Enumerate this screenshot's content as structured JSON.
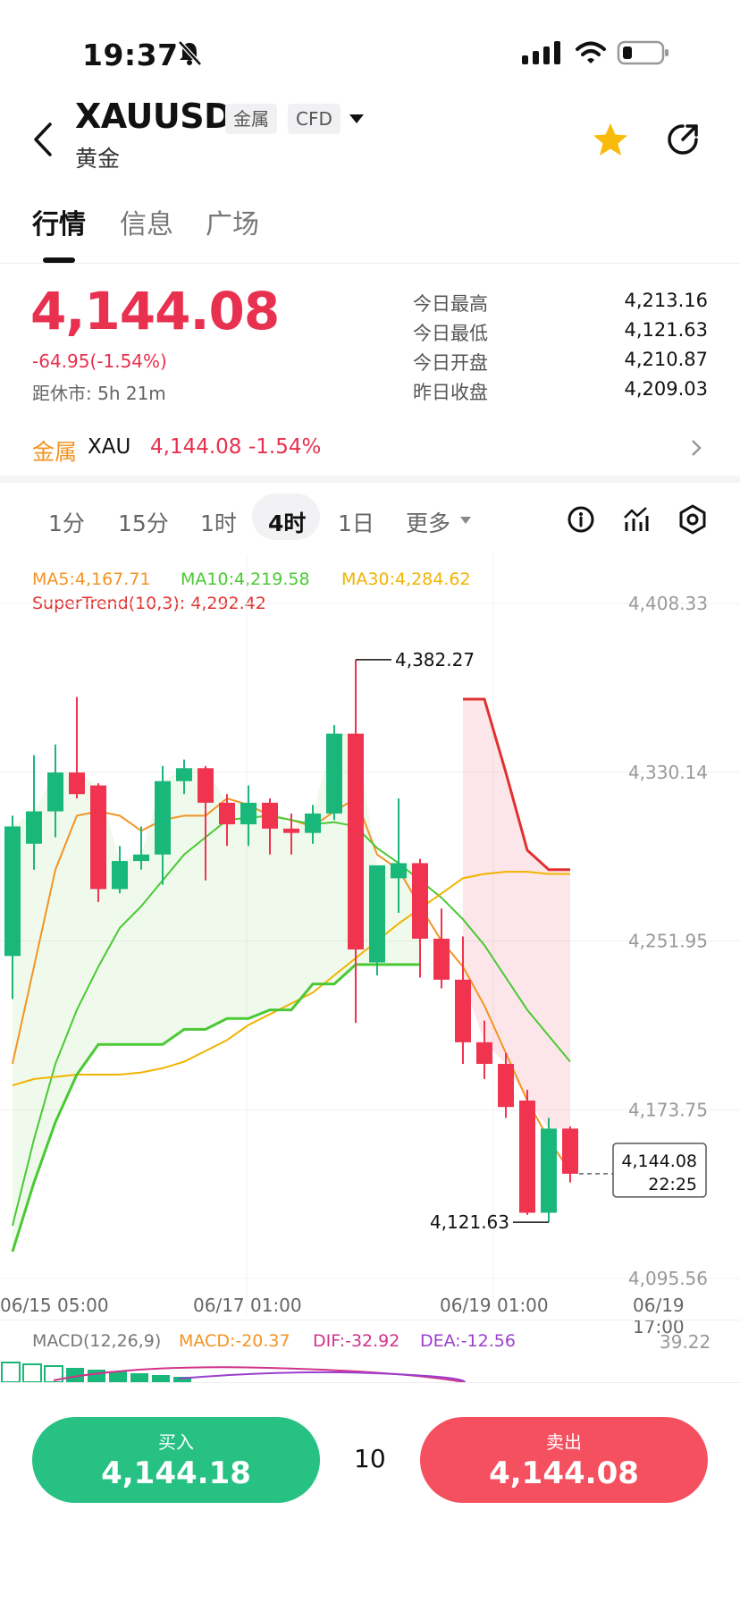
{
  "status_bar": {
    "time": "19:37"
  },
  "header": {
    "symbol": "XAUUSD",
    "name": "黄金",
    "tags": [
      "金属",
      "CFD"
    ]
  },
  "tabs": [
    {
      "label": "行情",
      "active": true
    },
    {
      "label": "信息",
      "active": false
    },
    {
      "label": "广场",
      "active": false
    }
  ],
  "quote": {
    "price": "4,144.08",
    "change": "-64.95(-1.54%)",
    "closing": "距休市: 5h 21m",
    "stats": [
      {
        "label": "今日最高",
        "value": "4,213.16"
      },
      {
        "label": "今日最低",
        "value": "4,121.63"
      },
      {
        "label": "今日开盘",
        "value": "4,210.87"
      },
      {
        "label": "昨日收盘",
        "value": "4,209.03"
      }
    ]
  },
  "related": {
    "category": "金属",
    "symbol": "XAU",
    "price": "4,144.08",
    "change": "-1.54%"
  },
  "periods": [
    {
      "label": "1分",
      "active": false
    },
    {
      "label": "15分",
      "active": false
    },
    {
      "label": "1时",
      "active": false
    },
    {
      "label": "4时",
      "active": true
    },
    {
      "label": "1日",
      "active": false
    },
    {
      "label": "更多",
      "active": false
    }
  ],
  "indicators": {
    "ma5": "MA5:4,167.71",
    "ma10": "MA10:4,219.58",
    "ma30": "MA30:4,284.62",
    "supertrend": "SuperTrend(10,3): 4,292.42"
  },
  "macd": {
    "title": "MACD(12,26,9)",
    "macd": "MACD:-20.37",
    "dif": "DIF:-32.92",
    "dea": "DEA:-12.56",
    "axis_value": "39.22"
  },
  "chart_data": {
    "type": "candlestick",
    "y_axis_labels": [
      "4,408.33",
      "4,330.14",
      "4,251.95",
      "4,173.75",
      "4,095.56"
    ],
    "x_axis_labels": [
      "06/15 05:00",
      "06/17 01:00",
      "06/19 01:00",
      "06/19 17:00"
    ],
    "ylim": [
      4095.56,
      4408.33
    ],
    "annotations": {
      "high": "4,382.27",
      "low": "4,121.63"
    },
    "last_price": {
      "price": "4,144.08",
      "countdown": "22:25"
    },
    "candles": [
      {
        "o": 4245,
        "h": 4310,
        "l": 4225,
        "c": 4305
      },
      {
        "o": 4297,
        "h": 4338,
        "l": 4285,
        "c": 4312
      },
      {
        "o": 4312,
        "h": 4343,
        "l": 4300,
        "c": 4330
      },
      {
        "o": 4330,
        "h": 4365,
        "l": 4318,
        "c": 4320
      },
      {
        "o": 4324,
        "h": 4325,
        "l": 4270,
        "c": 4276
      },
      {
        "o": 4276,
        "h": 4296,
        "l": 4274,
        "c": 4289
      },
      {
        "o": 4289,
        "h": 4305,
        "l": 4285,
        "c": 4292
      },
      {
        "o": 4292,
        "h": 4333,
        "l": 4278,
        "c": 4326
      },
      {
        "o": 4326,
        "h": 4336,
        "l": 4320,
        "c": 4332
      },
      {
        "o": 4332,
        "h": 4333,
        "l": 4280,
        "c": 4316
      },
      {
        "o": 4316,
        "h": 4320,
        "l": 4296,
        "c": 4306
      },
      {
        "o": 4306,
        "h": 4324,
        "l": 4296,
        "c": 4316
      },
      {
        "o": 4316,
        "h": 4318,
        "l": 4292,
        "c": 4304
      },
      {
        "o": 4304,
        "h": 4311,
        "l": 4292,
        "c": 4302
      },
      {
        "o": 4302,
        "h": 4315,
        "l": 4297,
        "c": 4311
      },
      {
        "o": 4311,
        "h": 4352,
        "l": 4308,
        "c": 4348
      },
      {
        "o": 4348,
        "h": 4382.27,
        "l": 4214,
        "c": 4248
      },
      {
        "o": 4242,
        "h": 4278,
        "l": 4236,
        "c": 4287
      },
      {
        "o": 4281,
        "h": 4318,
        "l": 4265,
        "c": 4288
      },
      {
        "o": 4288,
        "h": 4290,
        "l": 4235,
        "c": 4253
      },
      {
        "o": 4253,
        "h": 4267,
        "l": 4230,
        "c": 4234
      },
      {
        "o": 4234,
        "h": 4254,
        "l": 4195,
        "c": 4205
      },
      {
        "o": 4205,
        "h": 4215,
        "l": 4188,
        "c": 4195
      },
      {
        "o": 4195,
        "h": 4200,
        "l": 4170,
        "c": 4175
      },
      {
        "o": 4178,
        "h": 4183,
        "l": 4125,
        "c": 4126
      },
      {
        "o": 4126,
        "h": 4170,
        "l": 4121.63,
        "c": 4165
      },
      {
        "o": 4165,
        "h": 4166,
        "l": 4140,
        "c": 4144.08
      }
    ],
    "series": [
      {
        "name": "MA5",
        "values": [
          4195,
          4240,
          4285,
          4310,
          4312,
          4310,
          4303,
          4308,
          4310,
          4310,
          4318,
          4315,
          4310,
          4308,
          4305,
          4312,
          4318,
          4292,
          4285,
          4268,
          4252,
          4240,
          4222,
          4200,
          4178,
          4160,
          4145
        ]
      },
      {
        "name": "MA10",
        "values": [
          4120,
          4160,
          4195,
          4220,
          4240,
          4258,
          4268,
          4280,
          4292,
          4300,
          4308,
          4309,
          4310,
          4308,
          4306,
          4307,
          4305,
          4295,
          4288,
          4280,
          4272,
          4262,
          4250,
          4235,
          4220,
          4208,
          4196
        ]
      },
      {
        "name": "MA30",
        "values": [
          4185,
          4188,
          4189,
          4190,
          4190,
          4190,
          4191,
          4193,
          4196,
          4201,
          4206,
          4213,
          4218,
          4223,
          4228,
          4236,
          4244,
          4252,
          4260,
          4267,
          4274,
          4281,
          4283,
          4284,
          4284,
          4283,
          4283
        ]
      },
      {
        "name": "SuperTrend",
        "values": [
          4108,
          4140,
          4168,
          4190,
          4204,
          4204,
          4204,
          4204,
          4211,
          4211,
          4216,
          4216,
          4220,
          4220,
          4232,
          4232,
          4241,
          4241,
          4241,
          4241,
          null,
          4364,
          4364,
          4330,
          4294,
          4285,
          4285
        ]
      }
    ]
  },
  "trade": {
    "buy": {
      "label": "买入",
      "price": "4,144.18"
    },
    "quantity": "10",
    "sell": {
      "label": "卖出",
      "price": "4,144.08"
    }
  },
  "colors": {
    "up": "#19b77a",
    "down": "#f0334f",
    "ma5": "#f39423",
    "ma10": "#4ac934",
    "ma30": "#f0b400",
    "supertrend": "#e03131",
    "buy_button": "#27c184",
    "sell_button": "#f5505f",
    "star": "#f8bb0b"
  }
}
